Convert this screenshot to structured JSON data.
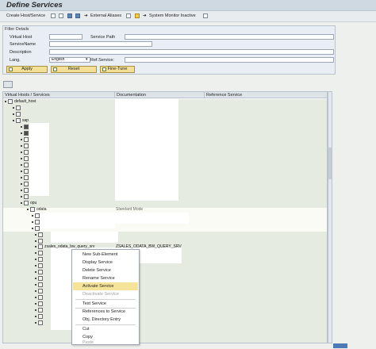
{
  "window": {
    "title": "Define Services"
  },
  "toolbar": {
    "create_label": "Create Host/Service",
    "external_aliases_label": "External Aliases",
    "system_monitor_label": "System Monitor Inactive"
  },
  "filter": {
    "section_title": "Filter Details",
    "virtual_host_label": "Virtual Host",
    "virtual_host_value": "",
    "service_path_label": "Service Path",
    "service_path_value": "",
    "service_name_label": "ServiceName",
    "service_name_value": "",
    "description_label": "Description",
    "description_value": "",
    "lang_label": "Lang.",
    "lang_value": "English",
    "ref_service_label": "Ref.Service:",
    "ref_service_value": "",
    "apply_label": "Apply",
    "reset_label": "Reset",
    "finetune_label": "Fine-Tune"
  },
  "tree": {
    "col_virtual_hosts": "Virtual Hosts / Services",
    "col_documentation": "Documentation",
    "col_reference_service": "Reference Service",
    "nodes": {
      "default_host": "default_host",
      "sap": "sap",
      "opu": "opu",
      "odata": "odata",
      "odata_doc": "Standard Mode",
      "service": "zsales_odata_bw_query_srv",
      "service_doc": "ZSALES_ODATA_BW_QUERY_SRV"
    }
  },
  "context_menu": {
    "items": [
      "New Sub-Element",
      "Display Service",
      "Delete Service",
      "Rename Service",
      "Activate Service",
      "Deactivate Service",
      "Test Service",
      "References to Service",
      "Obj. Directory Entry",
      "Cut",
      "Copy",
      "Paste"
    ],
    "highlighted": "Activate Service"
  },
  "colors": {
    "highlight": "#f5e39a",
    "button": "#f4df96",
    "titlebar": "#cfd9e2"
  }
}
